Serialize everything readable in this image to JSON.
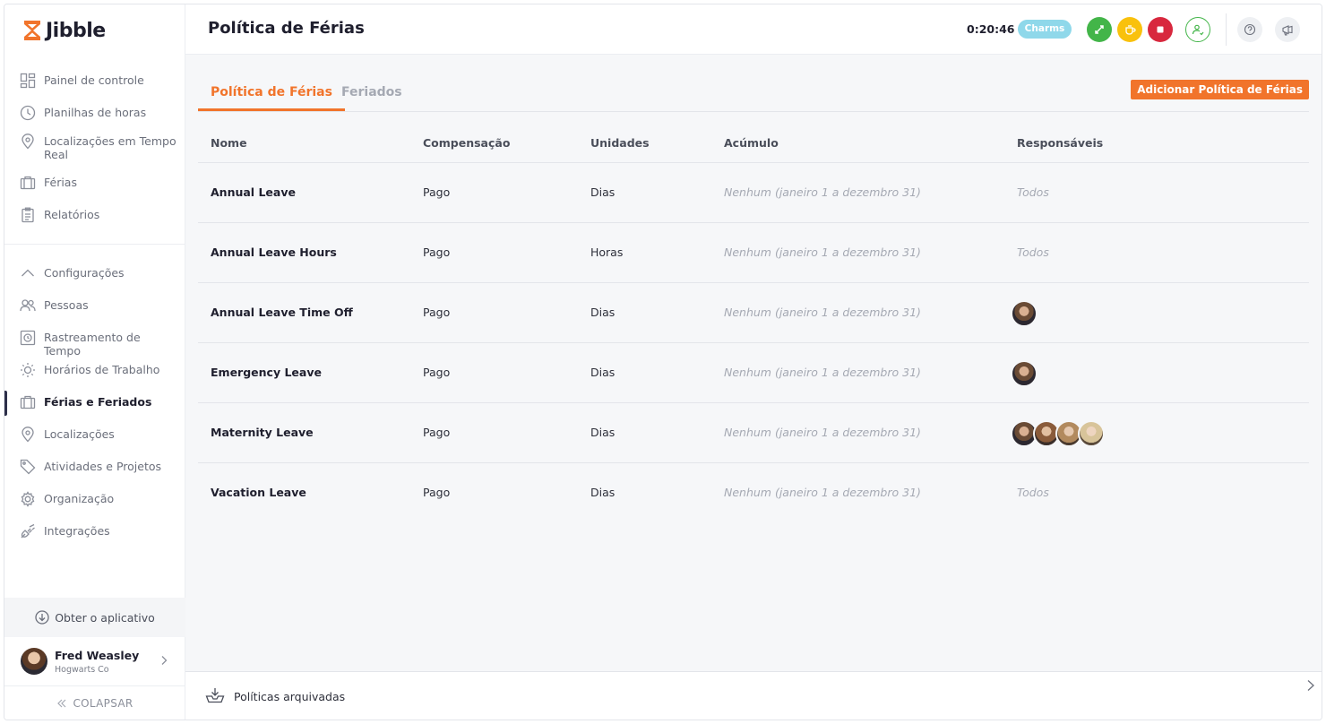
{
  "app": {
    "brand": "Jibble",
    "brand_color": "#f1742b"
  },
  "sidebar": {
    "items": [
      {
        "label": "Painel de controle",
        "icon": "dashboard-icon"
      },
      {
        "label": "Planilhas de horas",
        "icon": "clock-icon"
      },
      {
        "label": "Localizações em Tempo Real",
        "icon": "location-pin-icon"
      },
      {
        "label": "Férias",
        "icon": "suitcase-icon"
      },
      {
        "label": "Relatórios",
        "icon": "clipboard-icon"
      }
    ],
    "settings_header": {
      "label": "Configurações",
      "icon": "chevron-up-icon"
    },
    "settings_items": [
      {
        "label": "Pessoas",
        "icon": "people-icon"
      },
      {
        "label": "Rastreamento de Tempo",
        "icon": "time-tracking-icon"
      },
      {
        "label": "Horários de Trabalho",
        "icon": "sun-icon"
      },
      {
        "label": "Férias e Feriados",
        "icon": "suitcase-icon",
        "active": true
      },
      {
        "label": "Localizações",
        "icon": "location-pin-icon"
      },
      {
        "label": "Atividades e Projetos",
        "icon": "tag-icon"
      },
      {
        "label": "Organização",
        "icon": "gear-icon"
      },
      {
        "label": "Integrações",
        "icon": "plug-icon"
      }
    ],
    "get_app_label": "Obter o aplicativo",
    "user": {
      "name": "Fred Weasley",
      "org": "Hogwarts Co"
    },
    "collapse_label": "COLAPSAR"
  },
  "header": {
    "title": "Política de Férias",
    "timer": "0:20:46",
    "charms_label": "Charms",
    "action_colors": {
      "green": "#43b549",
      "yellow": "#f9c10d",
      "red": "#d8283e"
    }
  },
  "tabs": [
    {
      "label": "Política de Férias",
      "active": true
    },
    {
      "label": "Feriados",
      "active": false
    }
  ],
  "add_button_label": "Adicionar Política de Férias",
  "table": {
    "headers": [
      "Nome",
      "Compensação",
      "Unidades",
      "Acúmulo",
      "Responsáveis"
    ],
    "rows": [
      {
        "name": "Annual Leave",
        "compensation": "Pago",
        "units": "Dias",
        "accrual": "Nenhum (janeiro 1 a dezembro 31)",
        "assignees": "Todos"
      },
      {
        "name": "Annual Leave Hours",
        "compensation": "Pago",
        "units": "Horas",
        "accrual": "Nenhum (janeiro 1 a dezembro 31)",
        "assignees": "Todos"
      },
      {
        "name": "Annual Leave Time Off",
        "compensation": "Pago",
        "units": "Dias",
        "accrual": "Nenhum (janeiro 1 a dezembro 31)",
        "avatars": 1
      },
      {
        "name": "Emergency Leave",
        "compensation": "Pago",
        "units": "Dias",
        "accrual": "Nenhum (janeiro 1 a dezembro 31)",
        "avatars": 1
      },
      {
        "name": "Maternity Leave",
        "compensation": "Pago",
        "units": "Dias",
        "accrual": "Nenhum (janeiro 1 a dezembro 31)",
        "avatars": 4
      },
      {
        "name": "Vacation Leave",
        "compensation": "Pago",
        "units": "Dias",
        "accrual": "Nenhum (janeiro 1 a dezembro 31)",
        "assignees": "Todos"
      }
    ]
  },
  "footer": {
    "archived_label": "Políticas arquivadas"
  }
}
